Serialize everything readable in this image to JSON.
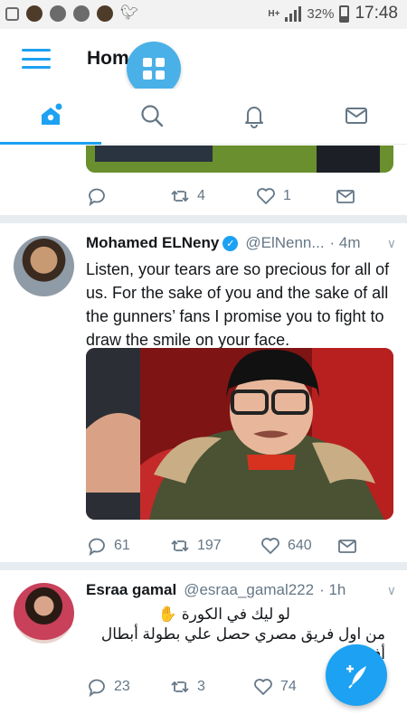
{
  "status_bar": {
    "network": "H+",
    "battery_percent": "32%",
    "time": "17:48"
  },
  "header": {
    "title": "Home"
  },
  "tabs": [
    {
      "name": "home",
      "icon": "home-icon",
      "active": true
    },
    {
      "name": "search",
      "icon": "search-icon",
      "active": false
    },
    {
      "name": "notifications",
      "icon": "bell-icon",
      "active": false
    },
    {
      "name": "messages",
      "icon": "envelope-icon",
      "active": false
    }
  ],
  "colors": {
    "accent": "#1da1f2",
    "text": "#14171a",
    "muted": "#657786",
    "divider": "#e6ecf0"
  },
  "feed": {
    "prev_tweet": {
      "replies": "",
      "retweets": "4",
      "likes": "1"
    },
    "tweets": [
      {
        "name": "Mohamed ELNeny",
        "verified": true,
        "handle": "@ElNenn...",
        "time": "· 4m",
        "text": "Listen, your tears are so precious for all of us. For the sake of you and the sake of all the gunners’ fans I promise you to fight to draw the smile on your face.",
        "replies": "61",
        "retweets": "197",
        "likes": "640"
      },
      {
        "name": "Esraa gamal",
        "verified": false,
        "handle": "@esraa_gamal222",
        "time": "· 1h",
        "text_line1": "لو ليك في الكورة ✋",
        "text_line2": "من اول فريق مصري حصل علي بطولة أبطال",
        "text_line3": "أفريقيا",
        "replies": "23",
        "retweets": "3",
        "likes": "74"
      }
    ]
  }
}
